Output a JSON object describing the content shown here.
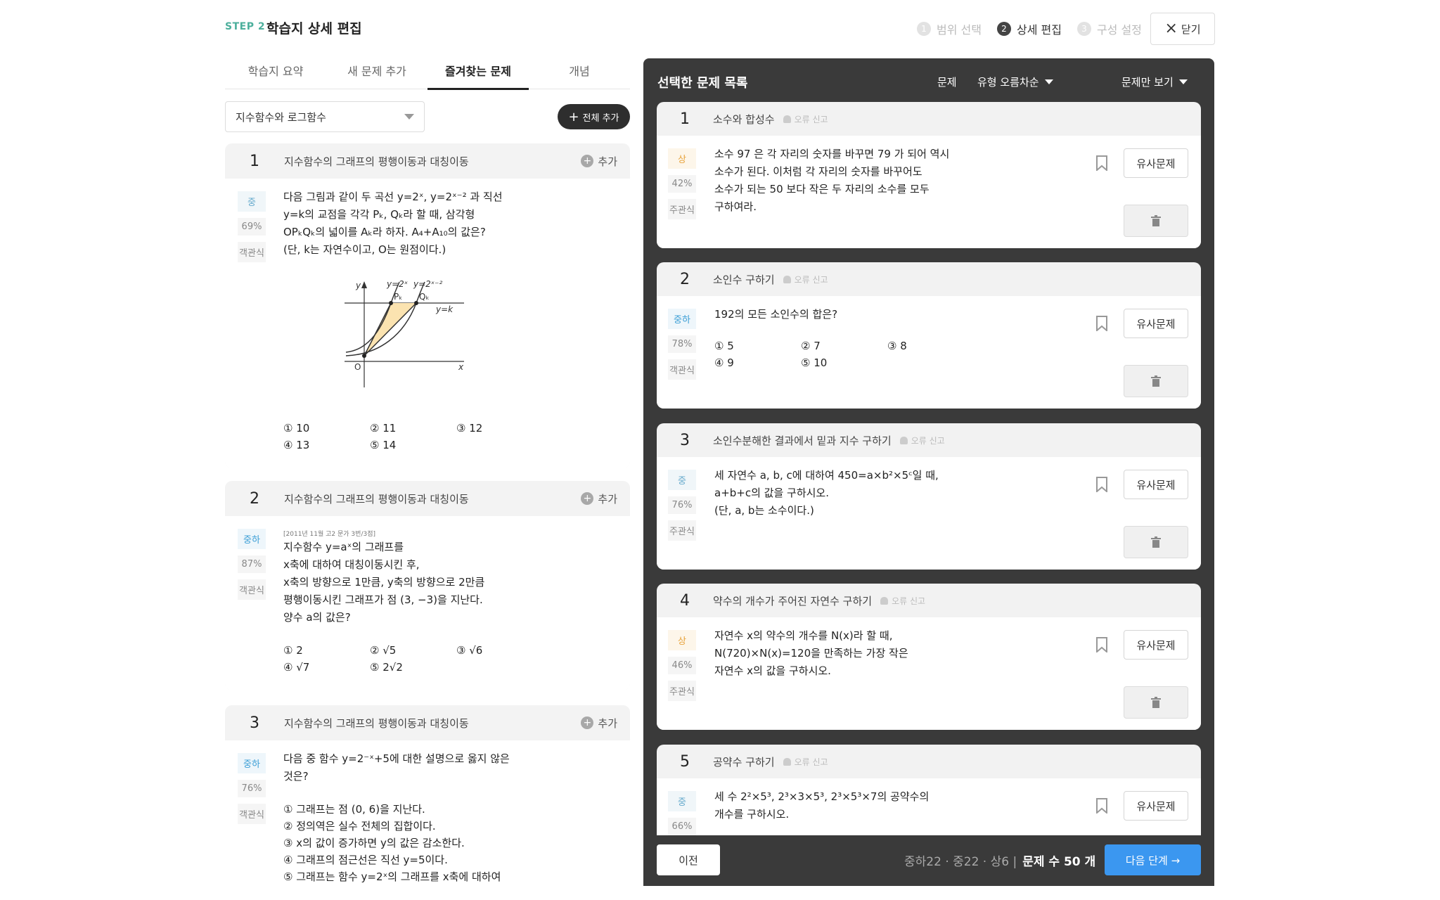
{
  "header": {
    "step_tag": "STEP 2",
    "title": "학습지 상세 편집",
    "steps": [
      {
        "num": "1",
        "label": "범위 선택"
      },
      {
        "num": "2",
        "label": "상세 편집"
      },
      {
        "num": "3",
        "label": "구성 설정"
      }
    ],
    "close_label": "닫기"
  },
  "tabs": [
    "학습지 요약",
    "새 문제 추가",
    "즐겨찾는 문제",
    "개념"
  ],
  "chapter_select": "지수함수와 로그함수",
  "add_all_label": "전체 추가",
  "left_cards": [
    {
      "num": "1",
      "topic": "지수함수의 그래프의 평행이동과 대칭이동",
      "add": "추가",
      "level": "중",
      "rate": "69%",
      "type": "객관식",
      "lines": [
        "다음 그림과 같이 두 곡선 y=2ˣ, y=2ˣ⁻² 과 직선",
        "y=k의 교점을 각각 Pₖ, Qₖ라 할 때, 삼각형",
        "OPₖQₖ의 넓이를 Aₖ라 하자. A₄+A₁₀의 값은?",
        "(단, k는 자연수이고, O는 원점이다.)"
      ],
      "graph": {
        "curve1": "y=2ˣ",
        "curve2": "y=2ˣ⁻²",
        "line": "y=k",
        "P": "Pₖ",
        "Q": "Qₖ",
        "O": "O",
        "x": "x",
        "y": "y"
      },
      "choices": [
        "① 10",
        "② 11",
        "③ 12",
        "④ 13",
        "⑤ 14"
      ]
    },
    {
      "num": "2",
      "topic": "지수함수의 그래프의 평행이동과 대칭이동",
      "add": "추가",
      "level": "중하",
      "rate": "87%",
      "type": "객관식",
      "source": "[2011년 11월 고2 문가 3번/3점]",
      "lines": [
        "지수함수 y=aˣ의 그래프를",
        "x축에 대하여 대칭이동시킨 후,",
        "x축의 방향으로 1만큼, y축의 방향으로 2만큼",
        "평행이동시킨 그래프가 점 (3, −3)을 지난다.",
        "양수 a의 값은?"
      ],
      "choices": [
        "① 2",
        "② √5",
        "③ √6",
        "④ √7",
        "⑤ 2√2"
      ]
    },
    {
      "num": "3",
      "topic": "지수함수의 그래프의 평행이동과 대칭이동",
      "add": "추가",
      "level": "중하",
      "rate": "76%",
      "type": "객관식",
      "lines": [
        "다음 중 함수 y=2⁻ˣ+5에 대한 설명으로 옳지 않은",
        "것은?"
      ],
      "options": [
        "① 그래프는 점 (0, 6)을 지난다.",
        "② 정의역은 실수 전체의 집합이다.",
        "③ x의 값이 증가하면 y의 값은 감소한다.",
        "④ 그래프의 점근선은 직선 y=5이다.",
        "⑤ 그래프는 함수 y=2ˣ의 그래프를 x축에 대하여"
      ]
    }
  ],
  "right_panel": {
    "title": "선택한 문제 목록",
    "tool_problem": "문제",
    "tool_sort": "유형 오름차순",
    "tool_view": "문제만 보기",
    "report_label": "오류 신고",
    "similar_label": "유사문제",
    "cards": [
      {
        "num": "1",
        "topic": "소수와 합성수",
        "level": "상",
        "rate": "42%",
        "type": "주관식",
        "lines": [
          "소수 97 은 각 자리의 숫자를 바꾸면 79 가 되어 역시",
          "소수가 된다. 이처럼 각 자리의 숫자를 바꾸어도",
          "소수가 되는 50 보다 작은 두 자리의 소수를 모두",
          "구하여라."
        ]
      },
      {
        "num": "2",
        "topic": "소인수 구하기",
        "level": "중하",
        "rate": "78%",
        "type": "객관식",
        "lines": [
          "192의 모든 소인수의 합은?"
        ],
        "choices": [
          "① 5",
          "② 7",
          "③ 8",
          "④ 9",
          "⑤ 10"
        ]
      },
      {
        "num": "3",
        "topic": "소인수분해한 결과에서 밑과 지수 구하기",
        "level": "중",
        "rate": "76%",
        "type": "주관식",
        "lines": [
          "세 자연수 a, b, c에 대하여 450=a×b²×5ᶜ일 때,",
          "a+b+c의 값을 구하시오.",
          "(단, a, b는 소수이다.)"
        ]
      },
      {
        "num": "4",
        "topic": "약수의 개수가 주어진 자연수 구하기",
        "level": "상",
        "rate": "46%",
        "type": "주관식",
        "lines": [
          "자연수 x의 약수의 개수를 N(x)라 할 때,",
          "N(720)×N(x)=120을 만족하는 가장 작은",
          "자연수 x의 값을 구하시오."
        ]
      },
      {
        "num": "5",
        "topic": "공약수 구하기",
        "level": "중",
        "rate": "66%",
        "type": "",
        "lines": [
          "세 수 2²×5³, 2³×3×5³, 2³×5³×7의 공약수의",
          "개수를 구하시오."
        ]
      }
    ]
  },
  "footer": {
    "prev_label": "이전",
    "summary_counts": "중하22 · 중22 · 상6 |",
    "summary_total": "문제 수 50 개",
    "next_label": "다음 단계 →"
  },
  "colors": {
    "accent_blue": "#3b97f0",
    "panel_dark": "#3a3a3a",
    "level_high": "#e8a33c",
    "level_mid": "#66aacc",
    "step_tag": "#4caf9c"
  }
}
